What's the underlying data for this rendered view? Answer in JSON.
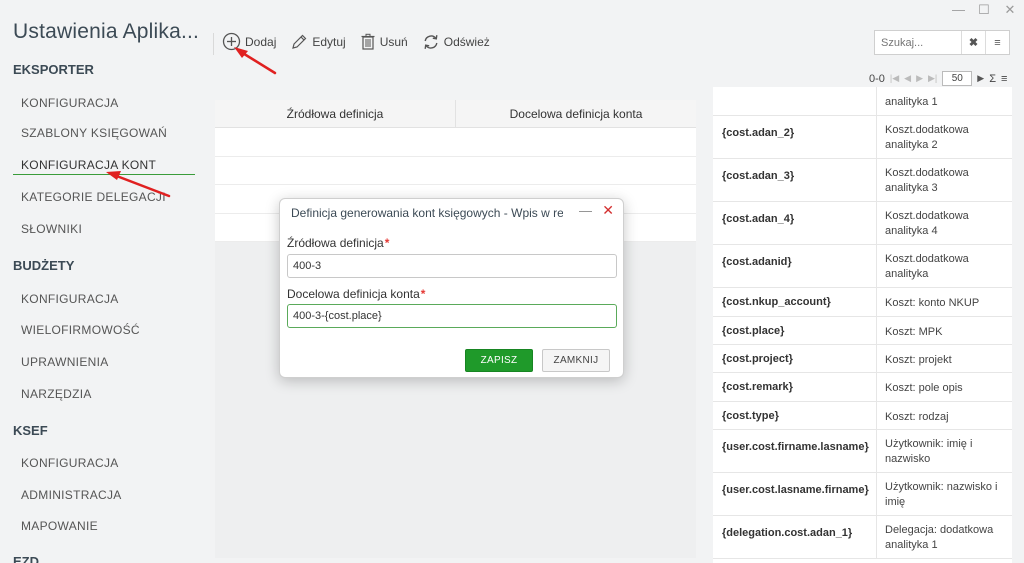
{
  "window": {
    "minimize": "—",
    "maximize": "☐",
    "close": "✕"
  },
  "app_title": "Ustawienia Aplika...",
  "sidebar": {
    "sections": [
      {
        "title": "EKSPORTER",
        "items": [
          "KONFIGURACJA",
          "SZABLONY KSIĘGOWAŃ",
          "KONFIGURACJA KONT",
          "KATEGORIE DELEGACJI",
          "SŁOWNIKI"
        ]
      },
      {
        "title": "BUDŻETY",
        "items": [
          "KONFIGURACJA",
          "WIELOFIRMOWOŚĆ",
          "UPRAWNIENIA",
          "NARZĘDZIA"
        ]
      },
      {
        "title": "KSEF",
        "items": [
          "KONFIGURACJA",
          "ADMINISTRACJA",
          "MAPOWANIE"
        ]
      },
      {
        "title": "EZD",
        "items": []
      }
    ],
    "active_item": "KONFIGURACJA KONT"
  },
  "toolbar": {
    "add": "Dodaj",
    "edit": "Edytuj",
    "delete": "Usuń",
    "refresh": "Odśwież"
  },
  "search": {
    "placeholder": "Szukaj...",
    "clear": "✖",
    "menu": "≡"
  },
  "pager": {
    "range": "0-0",
    "page_size": "50",
    "sum": "Σ",
    "menu": "≡"
  },
  "main_table": {
    "columns": [
      "Źródłowa definicja",
      "Docelowa definicja konta"
    ]
  },
  "variables": [
    {
      "key": "",
      "value": "analityka 1"
    },
    {
      "key": "{cost.adan_2}",
      "value": "Koszt.dodatkowa analityka 2"
    },
    {
      "key": "{cost.adan_3}",
      "value": "Koszt.dodatkowa analityka 3"
    },
    {
      "key": "{cost.adan_4}",
      "value": "Koszt.dodatkowa analityka 4"
    },
    {
      "key": "{cost.adanid}",
      "value": "Koszt.dodatkowa analityka"
    },
    {
      "key": "{cost.nkup_account}",
      "value": "Koszt: konto NKUP"
    },
    {
      "key": "{cost.place}",
      "value": "Koszt: MPK"
    },
    {
      "key": "{cost.project}",
      "value": "Koszt: projekt"
    },
    {
      "key": "{cost.remark}",
      "value": "Koszt: pole opis"
    },
    {
      "key": "{cost.type}",
      "value": "Koszt: rodzaj"
    },
    {
      "key": "{user.cost.firname.lasname}",
      "value": "Użytkownik: imię i nazwisko"
    },
    {
      "key": "{user.cost.lasname.firname}",
      "value": "Użytkownik: nazwisko i imię"
    },
    {
      "key": "{delegation.cost.adan_1}",
      "value": "Delegacja: dodatkowa analityka 1"
    }
  ],
  "dialog": {
    "title": "Definicja generowania kont księgowych - Wpis w reje...",
    "minimize": "—",
    "close": "✕",
    "source_label": "Źródłowa definicja",
    "source_value": "400-3",
    "target_label": "Docelowa definicja konta",
    "target_value": "400-3-{cost.place}",
    "required_mark": "*",
    "save": "ZAPISZ",
    "cancel": "ZAMKNIJ"
  },
  "colors": {
    "accent_green": "#1f9a2a",
    "annotation_red": "#e02020",
    "active_underline": "#3a9c3a"
  }
}
